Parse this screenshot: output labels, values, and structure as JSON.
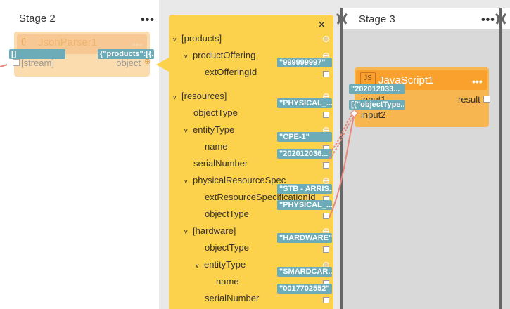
{
  "stage2": {
    "title": "Stage 2",
    "menu": "•••"
  },
  "json_parser": {
    "icon": "{}",
    "title": "JsonParser1",
    "menu": "•••",
    "input_label": "[stream]",
    "output_label": "object",
    "input_value": "[]",
    "output_value": "{\"products\":[{..."
  },
  "panel": {
    "close_icon": "×",
    "rows": [
      {
        "label": "[products]",
        "caret": "v",
        "value": ""
      },
      {
        "label": "productOffering",
        "caret": "v",
        "value": ""
      },
      {
        "label": "extOfferingId",
        "caret": "",
        "value": "\"999999997\""
      },
      {
        "label": "[resources]",
        "caret": "v",
        "value": ""
      },
      {
        "label": "objectType",
        "caret": "",
        "value": "\"PHYSICAL_..."
      },
      {
        "label": "entityType",
        "caret": "v",
        "value": ""
      },
      {
        "label": "name",
        "caret": "",
        "value": "\"CPE-1\""
      },
      {
        "label": "serialNumber",
        "caret": "",
        "value": "\"202012036..."
      },
      {
        "label": "physicalResourceSpec",
        "caret": "v",
        "value": "\"STB - ARRIS..."
      },
      {
        "label": "extResourceSpecificationId",
        "caret": "",
        "value": ""
      },
      {
        "label": "objectType",
        "caret": "",
        "value": "\"PHYSICAL_..."
      },
      {
        "label": "[hardware]",
        "caret": "v",
        "value": ""
      },
      {
        "label": "objectType",
        "caret": "",
        "value": "\"HARDWARE\""
      },
      {
        "label": "entityType",
        "caret": "v",
        "value": "\"SMARDCAR..."
      },
      {
        "label": "name",
        "caret": "",
        "value": "\"0017702552\""
      },
      {
        "label": "serialNumber",
        "caret": "",
        "value": ""
      }
    ]
  },
  "stage3": {
    "title": "Stage 3",
    "menu": "•••"
  },
  "javascript_node": {
    "icon": "JS",
    "title": "JavaScript1",
    "menu": "•••",
    "input1_label": "input1",
    "input2_label": "input2",
    "output_label": "result",
    "input1_value": "\"202012033...",
    "input2_value": "[{\"objectType..."
  },
  "colors": {
    "panel": "#fcd24c",
    "badge": "#6cabb8",
    "wire": "#e8877a",
    "js_node": "#f7b64f"
  }
}
